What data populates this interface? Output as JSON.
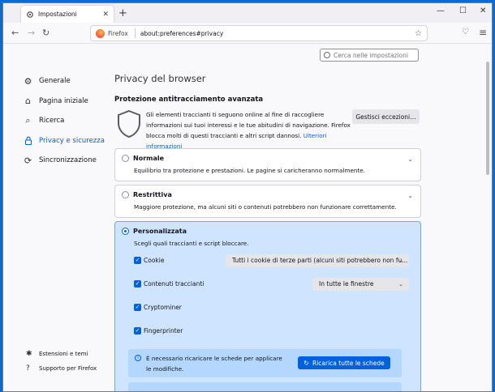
{
  "tab": {
    "title": "Impostazioni",
    "close": "✕",
    "new_tab": "+"
  },
  "window_controls": {
    "minimize": "—",
    "maximize": "☐",
    "close": "✕"
  },
  "navbar": {
    "back": "←",
    "forward": "→",
    "reload": "↻",
    "brand": "Firefox",
    "url": "about:preferences#privacy",
    "bookmark": "☆",
    "pocket": "♡",
    "menu": "≡"
  },
  "search": {
    "placeholder": "Cerca nelle impostazioni"
  },
  "sidebar": {
    "items": [
      {
        "label": "Generale",
        "icon": "gear-icon",
        "glyph": "⚙"
      },
      {
        "label": "Pagina iniziale",
        "icon": "home-icon",
        "glyph": "⌂"
      },
      {
        "label": "Ricerca",
        "icon": "search-icon",
        "glyph": "⌕"
      },
      {
        "label": "Privacy e sicurezza",
        "icon": "lock-icon",
        "glyph": "🔒"
      },
      {
        "label": "Sincronizzazione",
        "icon": "sync-icon",
        "glyph": "⟳"
      }
    ],
    "active_index": 3,
    "bottom": [
      {
        "label": "Estensioni e temi",
        "icon": "puzzle-icon",
        "glyph": "✱"
      },
      {
        "label": "Supporto per Firefox",
        "icon": "help-icon",
        "glyph": "?"
      }
    ]
  },
  "main": {
    "title": "Privacy del browser",
    "etp": {
      "heading": "Protezione antitracciamento avanzata",
      "text": "Gli elementi traccianti ti seguono online al fine di raccogliere informazioni sui tuoi interessi e le tue abitudini di navigazione. Firefox blocca molti di questi traccianti e altri script dannosi.",
      "link": "Ulteriori informazioni",
      "exceptions_button": "Gestisci eccezioni…"
    },
    "modes": [
      {
        "label": "Normale",
        "desc": "Equilibrio tra protezione e prestazioni. Le pagine si caricheranno normalmente.",
        "checked": false
      },
      {
        "label": "Restrittiva",
        "desc": "Maggiore protezione, ma alcuni siti o contenuti potrebbero non funzionare correttamente.",
        "checked": false
      },
      {
        "label": "Personalizzata",
        "desc": "Scegli quali traccianti e script bloccare.",
        "checked": true
      }
    ],
    "custom_options": [
      {
        "label": "Cookie",
        "checked": true,
        "select": "Tutti i cookie di terze parti (alcuni siti potrebbero non fu..."
      },
      {
        "label": "Contenuti traccianti",
        "checked": true,
        "select": "In tutte le finestre"
      },
      {
        "label": "Cryptominer",
        "checked": true
      },
      {
        "label": "Fingerprinter",
        "checked": true
      }
    ],
    "notice": {
      "text": "È necessario ricaricare le schede per applicare le modifiche.",
      "button": "Ricarica tutte le schede"
    }
  }
}
